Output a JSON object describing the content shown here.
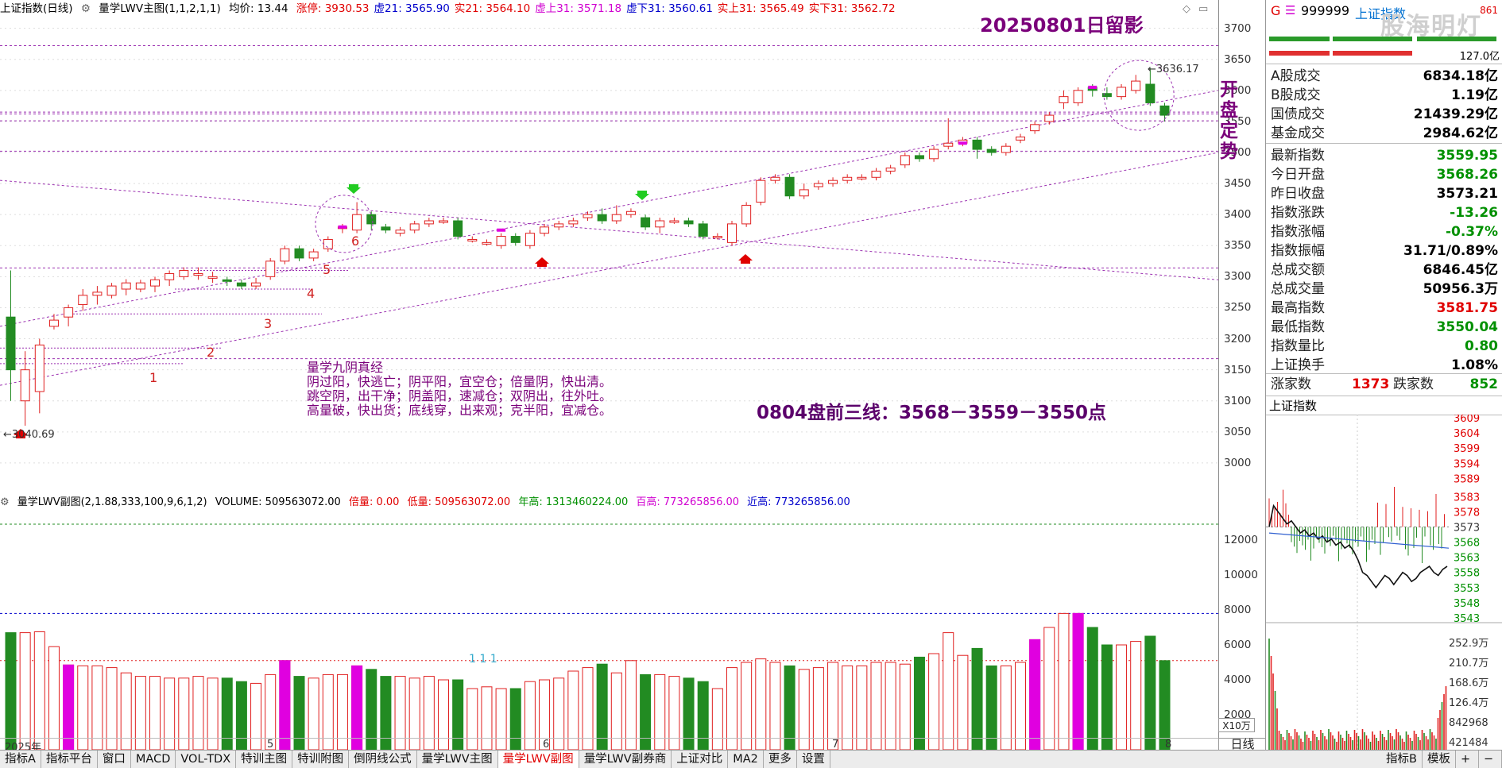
{
  "main_header": {
    "title": "上证指数(日线)",
    "indicator": "量学LWV主图(1,1,2,1,1)",
    "avg": "均价: 13.44",
    "items": [
      {
        "label": "涨停: 3930.53",
        "color": "#e00000"
      },
      {
        "label": "虚21: 3565.90",
        "color": "#0000cc"
      },
      {
        "label": "实21: 3564.10",
        "color": "#e00000"
      },
      {
        "label": "虚上31: 3571.18",
        "color": "#d000d0"
      },
      {
        "label": "虚下31: 3560.61",
        "color": "#0000cc"
      },
      {
        "label": "实上31: 3565.49",
        "color": "#e00000"
      },
      {
        "label": "实下31: 3562.72",
        "color": "#e00000"
      }
    ]
  },
  "annotations": {
    "date_title": "20250801日留影",
    "kaipan": [
      "开",
      "盘",
      "定",
      "势"
    ],
    "high_label": "3636.17",
    "low_label": "3040.69",
    "three_lines": "0804盘前三线：3568－3559－3550点",
    "nine_yin_title": "量学九阴真经",
    "nine_yin_lines": [
      "阴过阳，快逃亡；阴平阳，宜空仓；倍量阴，快出清。",
      "跳空阴，出干净；阴盖阳，速减仓；双阴出，往外吐。",
      "高量破，快出货；底线穿，出来观；克半阳，宜减仓。"
    ],
    "line_numbers": [
      "1",
      "2",
      "3",
      "4",
      "5",
      "6"
    ],
    "vol_marks": "1  1  1"
  },
  "sub_header": {
    "indicator": "量学LWV副图(2,1.88,333,100,9,6,1,2)",
    "volume": "VOLUME: 509563072.00",
    "bei": "倍量: 0.00",
    "di": "低量: 509563072.00",
    "nian": "年高: 1313460224.00",
    "bai": "百高: 773265856.00",
    "jin": "近高: 773265856.00"
  },
  "price_axis": [
    "3700",
    "3650",
    "3600",
    "3550",
    "3500",
    "3450",
    "3400",
    "3350",
    "3300",
    "3250",
    "3200",
    "3150",
    "3100",
    "3050",
    "3000"
  ],
  "vol_axis": [
    "12000",
    "10000",
    "8000",
    "6000",
    "4000",
    "2000"
  ],
  "vol_unit": "X10万",
  "x_axis": {
    "labels": [
      "2025年",
      "5",
      "6",
      "7",
      "8"
    ],
    "period": "日线"
  },
  "chart_data": {
    "type": "candlestick",
    "title": "上证指数(日线)",
    "candles": [
      [
        3235,
        3150,
        3310,
        3100
      ],
      [
        3100,
        3150,
        3180,
        3060
      ],
      [
        3115,
        3190,
        3200,
        3080
      ],
      [
        3220,
        3230,
        3240,
        3215
      ],
      [
        3235,
        3250,
        3255,
        3220
      ],
      [
        3255,
        3270,
        3280,
        3245
      ],
      [
        3270,
        3275,
        3285,
        3255
      ],
      [
        3270,
        3285,
        3290,
        3265
      ],
      [
        3280,
        3290,
        3296,
        3270
      ],
      [
        3280,
        3290,
        3295,
        3275
      ],
      [
        3285,
        3295,
        3300,
        3275
      ],
      [
        3295,
        3305,
        3310,
        3285
      ],
      [
        3300,
        3310,
        3315,
        3295
      ],
      [
        3305,
        3305,
        3315,
        3295
      ],
      [
        3300,
        3300,
        3308,
        3290
      ],
      [
        3295,
        3293,
        3300,
        3285
      ],
      [
        3290,
        3285,
        3295,
        3280
      ],
      [
        3285,
        3290,
        3298,
        3280
      ],
      [
        3300,
        3325,
        3330,
        3295
      ],
      [
        3325,
        3345,
        3350,
        3320
      ],
      [
        3345,
        3330,
        3350,
        3325
      ],
      [
        3330,
        3340,
        3345,
        3325
      ],
      [
        3345,
        3360,
        3365,
        3340
      ],
      [
        3380,
        3380,
        3385,
        3370
      ],
      [
        3375,
        3400,
        3420,
        3370
      ],
      [
        3400,
        3385,
        3405,
        3375
      ],
      [
        3380,
        3375,
        3385,
        3370
      ],
      [
        3370,
        3375,
        3380,
        3365
      ],
      [
        3375,
        3385,
        3390,
        3370
      ],
      [
        3385,
        3390,
        3395,
        3380
      ],
      [
        3390,
        3390,
        3395,
        3385
      ],
      [
        3390,
        3365,
        3395,
        3360
      ],
      [
        3360,
        3360,
        3365,
        3355
      ],
      [
        3355,
        3355,
        3360,
        3350
      ],
      [
        3350,
        3365,
        3370,
        3345
      ],
      [
        3365,
        3355,
        3370,
        3350
      ],
      [
        3350,
        3370,
        3375,
        3345
      ],
      [
        3370,
        3380,
        3385,
        3365
      ],
      [
        3380,
        3385,
        3390,
        3375
      ],
      [
        3385,
        3390,
        3395,
        3380
      ],
      [
        3395,
        3400,
        3405,
        3390
      ],
      [
        3400,
        3390,
        3410,
        3385
      ],
      [
        3390,
        3400,
        3415,
        3385
      ],
      [
        3400,
        3405,
        3410,
        3395
      ],
      [
        3395,
        3380,
        3400,
        3375
      ],
      [
        3380,
        3390,
        3395,
        3370
      ],
      [
        3390,
        3390,
        3395,
        3385
      ],
      [
        3390,
        3385,
        3395,
        3380
      ],
      [
        3385,
        3365,
        3390,
        3360
      ],
      [
        3365,
        3365,
        3370,
        3360
      ],
      [
        3355,
        3385,
        3390,
        3350
      ],
      [
        3385,
        3415,
        3420,
        3380
      ],
      [
        3420,
        3455,
        3460,
        3415
      ],
      [
        3455,
        3460,
        3465,
        3450
      ],
      [
        3460,
        3430,
        3465,
        3425
      ],
      [
        3430,
        3440,
        3450,
        3425
      ],
      [
        3445,
        3450,
        3455,
        3440
      ],
      [
        3450,
        3455,
        3460,
        3445
      ],
      [
        3455,
        3460,
        3465,
        3450
      ],
      [
        3460,
        3460,
        3465,
        3455
      ],
      [
        3460,
        3470,
        3475,
        3455
      ],
      [
        3470,
        3475,
        3480,
        3465
      ],
      [
        3480,
        3495,
        3500,
        3475
      ],
      [
        3495,
        3490,
        3500,
        3485
      ],
      [
        3490,
        3505,
        3510,
        3485
      ],
      [
        3510,
        3515,
        3555,
        3505
      ],
      [
        3515,
        3520,
        3525,
        3510
      ],
      [
        3520,
        3505,
        3525,
        3490
      ],
      [
        3505,
        3500,
        3510,
        3495
      ],
      [
        3500,
        3510,
        3515,
        3495
      ],
      [
        3520,
        3525,
        3530,
        3515
      ],
      [
        3535,
        3545,
        3550,
        3530
      ],
      [
        3550,
        3560,
        3565,
        3545
      ],
      [
        3580,
        3590,
        3600,
        3570
      ],
      [
        3580,
        3600,
        3605,
        3575
      ],
      [
        3605,
        3600,
        3610,
        3590
      ],
      [
        3595,
        3590,
        3605,
        3585
      ],
      [
        3590,
        3605,
        3610,
        3585
      ],
      [
        3600,
        3615,
        3625,
        3595
      ],
      [
        3610,
        3580,
        3636,
        3575
      ],
      [
        3575,
        3560,
        3580,
        3550
      ]
    ],
    "volumes": [
      6700,
      6700,
      6750,
      5900,
      4850,
      4800,
      4800,
      4700,
      4400,
      4200,
      4200,
      4100,
      4100,
      4200,
      4100,
      4100,
      3900,
      3800,
      4300,
      5100,
      4200,
      4100,
      4300,
      4300,
      4800,
      4600,
      4200,
      4200,
      4100,
      4200,
      4000,
      4000,
      3500,
      3600,
      3500,
      3500,
      3900,
      4000,
      4100,
      4500,
      4700,
      4900,
      4400,
      5100,
      4300,
      4300,
      4200,
      4100,
      3900,
      3500,
      4700,
      5000,
      5200,
      5000,
      4800,
      4600,
      4700,
      5000,
      4800,
      4800,
      5000,
      5000,
      4900,
      5300,
      5500,
      6700,
      5400,
      5800,
      4800,
      4800,
      5000,
      6300,
      7000,
      7800,
      7800,
      7000,
      6000,
      6000,
      6200,
      6500,
      5100
    ],
    "volume_unit": "X10万",
    "ylim": [
      2950,
      3720
    ],
    "vol_ylim": [
      0,
      13000
    ],
    "x_labels": [
      "2025年",
      "5",
      "6",
      "7",
      "8"
    ]
  },
  "right_panel": {
    "symbol": "999999",
    "name": "上证指数",
    "g_label": "G",
    "small_top": "861",
    "small_sub": "127.0亿",
    "watermark": "股海明灯",
    "top_rows": [
      {
        "k": "A股成交",
        "v": "6834.18亿",
        "c": "#000000"
      },
      {
        "k": "B股成交",
        "v": "1.19亿",
        "c": "#000000"
      },
      {
        "k": "国债成交",
        "v": "21439.29亿",
        "c": "#000000"
      },
      {
        "k": "基金成交",
        "v": "2984.62亿",
        "c": "#000000"
      }
    ],
    "rows": [
      {
        "k": "最新指数",
        "v": "3559.95",
        "c": "#009000"
      },
      {
        "k": "今日开盘",
        "v": "3568.26",
        "c": "#009000"
      },
      {
        "k": "昨日收盘",
        "v": "3573.21",
        "c": "#000000"
      },
      {
        "k": "指数涨跌",
        "v": "-13.26",
        "c": "#009000"
      },
      {
        "k": "指数涨幅",
        "v": "-0.37%",
        "c": "#009000"
      },
      {
        "k": "指数振幅",
        "v": "31.71/0.89%",
        "c": "#000000"
      },
      {
        "k": "总成交额",
        "v": "6846.45亿",
        "c": "#000000"
      },
      {
        "k": "总成交量",
        "v": "50956.3万",
        "c": "#000000"
      },
      {
        "k": "最高指数",
        "v": "3581.75",
        "c": "#e00000"
      },
      {
        "k": "最低指数",
        "v": "3550.04",
        "c": "#009000"
      },
      {
        "k": "指数量比",
        "v": "0.80",
        "c": "#009000"
      },
      {
        "k": "上证换手",
        "v": "1.08%",
        "c": "#000000"
      }
    ],
    "up_label": "涨家数",
    "up_val": "1373",
    "down_label": "跌家数",
    "down_val": "852",
    "mini_title": "上证指数",
    "mini_axis": [
      "3609",
      "3604",
      "3599",
      "3594",
      "3589",
      "3583",
      "3578",
      "3573",
      "3568",
      "3563",
      "3558",
      "3553",
      "3548",
      "3543"
    ],
    "mini_vol_axis": [
      "252.9万",
      "210.7万",
      "168.6万",
      "126.4万",
      "842968",
      "421484"
    ],
    "intraday": [
      3573,
      3580,
      3578,
      3576,
      3574,
      3575,
      3573,
      3571,
      3572,
      3570,
      3571,
      3569,
      3570,
      3568,
      3569,
      3567,
      3568,
      3566,
      3567,
      3565,
      3562,
      3558,
      3557,
      3555,
      3553,
      3555,
      3557,
      3556,
      3554,
      3556,
      3558,
      3557,
      3555,
      3556,
      3558,
      3559,
      3560,
      3558,
      3557,
      3559,
      3560
    ]
  },
  "tabs": [
    "指标A",
    "指标平台",
    "窗口",
    "MACD",
    "VOL-TDX",
    "特训主图",
    "特训附图",
    "倒阴线公式",
    "量学LWV主图",
    "量学LWV副图",
    "量学LWV副券商",
    "上证对比",
    "MA2",
    "更多",
    "设置"
  ],
  "tabs_right": [
    "指标B",
    "模板",
    "+",
    "−"
  ],
  "active_tab": "量学LWV副图"
}
